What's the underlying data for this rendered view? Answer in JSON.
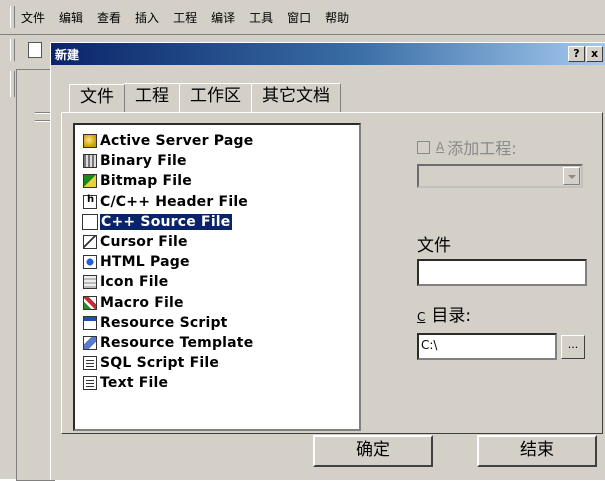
{
  "menubar": {
    "items": [
      "文件",
      "编辑",
      "查看",
      "插入",
      "工程",
      "编译",
      "工具",
      "窗口",
      "帮助"
    ]
  },
  "dialog": {
    "title": "新建",
    "help_glyph": "?",
    "close_glyph": "x",
    "tabs": [
      "文件",
      "工程",
      "工作区",
      "其它文档"
    ],
    "active_tab": "文件",
    "files": [
      {
        "label": "Active Server Page",
        "icon": "globe-page-icon"
      },
      {
        "label": "Binary File",
        "icon": "binary-file-icon"
      },
      {
        "label": "Bitmap File",
        "icon": "bitmap-file-icon"
      },
      {
        "label": "C/C++ Header File",
        "icon": "header-file-icon"
      },
      {
        "label": "C++ Source File",
        "icon": "cpp-file-icon",
        "selected": true
      },
      {
        "label": "Cursor File",
        "icon": "cursor-file-icon"
      },
      {
        "label": "HTML Page",
        "icon": "html-page-icon"
      },
      {
        "label": "Icon File",
        "icon": "icon-file-icon"
      },
      {
        "label": "Macro File",
        "icon": "macro-file-icon"
      },
      {
        "label": "Resource Script",
        "icon": "resource-script-icon"
      },
      {
        "label": "Resource Template",
        "icon": "resource-template-icon"
      },
      {
        "label": "SQL Script File",
        "icon": "sql-file-icon"
      },
      {
        "label": "Text File",
        "icon": "text-file-icon"
      }
    ],
    "add_to_project": {
      "accel": "A",
      "label": "添加工程:",
      "checked": false,
      "enabled": false
    },
    "file_label": "文件",
    "file_name_value": "",
    "dir_accel": "C",
    "dir_label": "目录:",
    "dir_value": "C:\\",
    "browse_label": "...",
    "ok_label": "确定",
    "end_label": "结束"
  }
}
